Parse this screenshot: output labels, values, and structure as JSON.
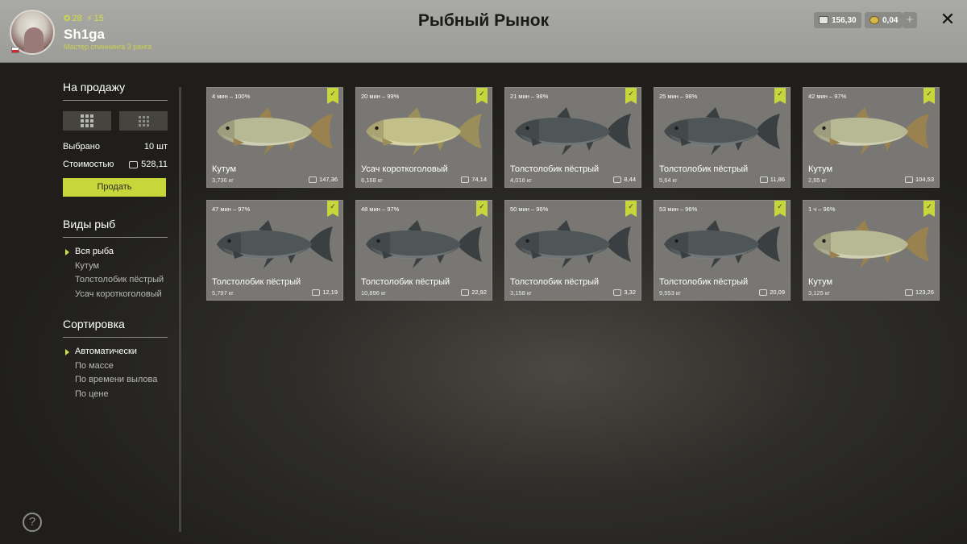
{
  "header": {
    "title": "Рыбный Рынок",
    "player": {
      "name": "Sh1ga",
      "rank_title": "Мастер спиннинга 3 ранга",
      "level": "28",
      "points": "15"
    },
    "money": "156,30",
    "gold": "0,04",
    "add_label": "+",
    "close_label": "✕"
  },
  "sidebar": {
    "for_sale_title": "На продажу",
    "selected_label": "Выбрано",
    "selected_value": "10 шт",
    "cost_label": "Стоимостью",
    "cost_value": "528,11",
    "sell_label": "Продать",
    "species_title": "Виды рыб",
    "species": [
      "Вся рыба",
      "Кутум",
      "Толстолобик пёстрый",
      "Усач короткоголовый"
    ],
    "species_active": 0,
    "sort_title": "Сортировка",
    "sort_options": [
      "Автоматически",
      "По массе",
      "По времени вылова",
      "По цене"
    ],
    "sort_active": 0,
    "help_label": "?"
  },
  "fish_cards": [
    {
      "time": "4 мин – 100%",
      "name": "Кутум",
      "weight": "3,736 кг",
      "price": "147,36",
      "kind": "kutum"
    },
    {
      "time": "20 мин – 99%",
      "name": "Усач короткоголовый",
      "weight": "6,168 кг",
      "price": "74,14",
      "kind": "barbel"
    },
    {
      "time": "21 мин – 98%",
      "name": "Толстолобик пёстрый",
      "weight": "4,016 кг",
      "price": "8,44",
      "kind": "carp"
    },
    {
      "time": "25 мин – 98%",
      "name": "Толстолобик пёстрый",
      "weight": "5,64 кг",
      "price": "11,86",
      "kind": "carp"
    },
    {
      "time": "42 мин – 97%",
      "name": "Кутум",
      "weight": "2,65 кг",
      "price": "104,53",
      "kind": "kutum"
    },
    {
      "time": "47 мин – 97%",
      "name": "Толстолобик пёстрый",
      "weight": "5,797 кг",
      "price": "12,19",
      "kind": "carp"
    },
    {
      "time": "48 мин – 97%",
      "name": "Толстолобик пёстрый",
      "weight": "10,896 кг",
      "price": "22,92",
      "kind": "carp"
    },
    {
      "time": "50 мин – 96%",
      "name": "Толстолобик пёстрый",
      "weight": "3,158 кг",
      "price": "3,32",
      "kind": "carp"
    },
    {
      "time": "53 мин – 96%",
      "name": "Толстолобик пёстрый",
      "weight": "9,553 кг",
      "price": "20,09",
      "kind": "carp"
    },
    {
      "time": "1 ч – 96%",
      "name": "Кутум",
      "weight": "3,125 кг",
      "price": "123,26",
      "kind": "kutum"
    }
  ],
  "colors": {
    "accent": "#c6d63b",
    "kutum_body": "#b7b894",
    "barbel_body": "#c2bf8a",
    "carp_body": "#4f5658"
  }
}
